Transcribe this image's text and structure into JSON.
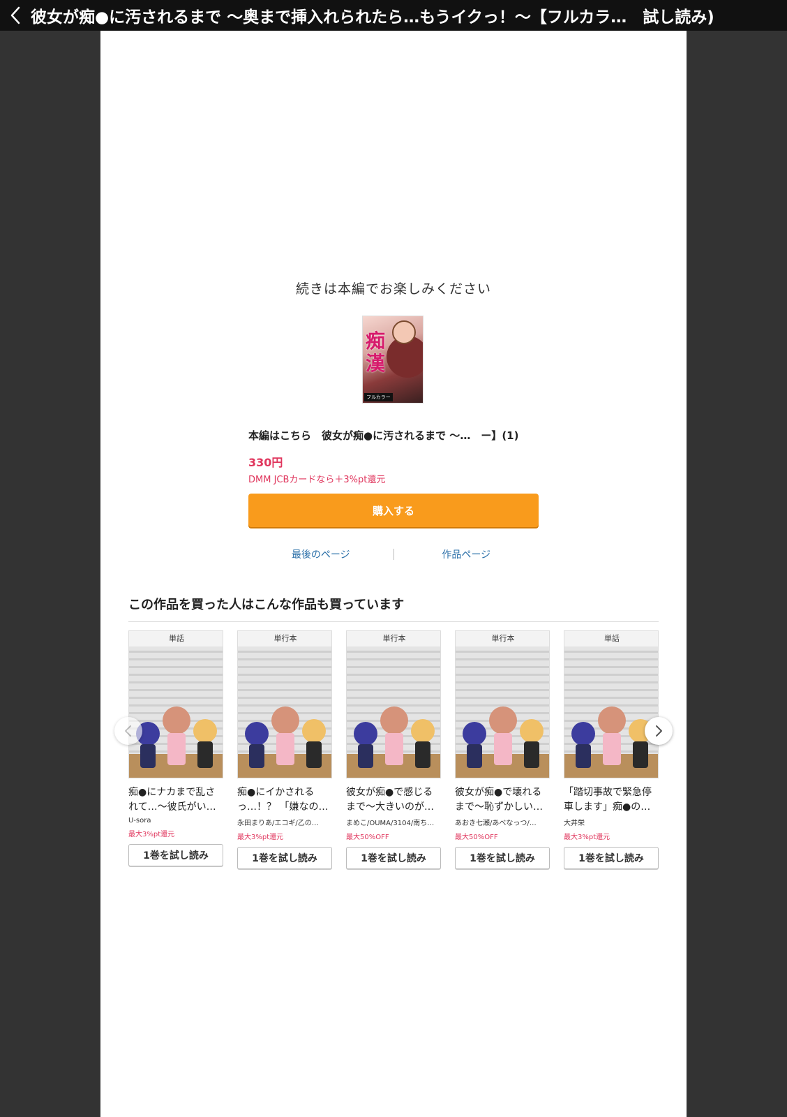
{
  "topbar": {
    "title": "彼女が痴●に汚されるまで 〜奥まで挿入れられたら…もうイクっ！〜【フルカラ…　試し読み)"
  },
  "viewer_end": {
    "continue_message": "続きは本編でお楽しみください",
    "cover": {
      "title_text": "痴漢",
      "label": "フルカラー"
    },
    "product_title": "本編はこちら　彼女が痴●に汚されるまで 〜…　ー】(1)",
    "price": "330円",
    "campaign": "DMM JCBカードなら＋3%pt還元",
    "buy_button": "購入する",
    "links": {
      "last_page": "最後のページ",
      "work_page": "作品ページ"
    }
  },
  "recommend": {
    "heading": "この作品を買った人はこんな作品も買っています",
    "items": [
      {
        "badge": "単話",
        "title": "痴●にナカまで乱されて…〜彼氏がい…",
        "author": "U-sora",
        "promo": "最大3%pt還元",
        "button": "1巻を試し読み"
      },
      {
        "badge": "単行本",
        "title": "痴●にイかされるっ…！？ 「嫌なの…",
        "author": "永田まりあ/エコギ/乙の…",
        "promo": "最大3%pt還元",
        "button": "1巻を試し読み"
      },
      {
        "badge": "単行本",
        "title": "彼女が痴●で感じるまで〜大きいのが…",
        "author": "まめこ/OUMA/3104/南ち…",
        "promo": "最大50%OFF",
        "button": "1巻を試し読み"
      },
      {
        "badge": "単行本",
        "title": "彼女が痴●で壊れるまで〜恥ずかしい…",
        "author": "あおき七瀬/あべなっつ/…",
        "promo": "最大50%OFF",
        "button": "1巻を試し読み"
      },
      {
        "badge": "単話",
        "title": "「踏切事故で緊急停車します」痴●の…",
        "author": "大井栄",
        "promo": "最大3%pt還元",
        "button": "1巻を試し読み"
      }
    ]
  },
  "colors": {
    "accent_orange": "#f99b1c",
    "price_red": "#e0365d",
    "link_blue": "#2a6fa8"
  },
  "icons": {
    "back": "chevron-left-icon",
    "carousel_prev": "chevron-left-icon",
    "carousel_next": "chevron-right-icon"
  }
}
